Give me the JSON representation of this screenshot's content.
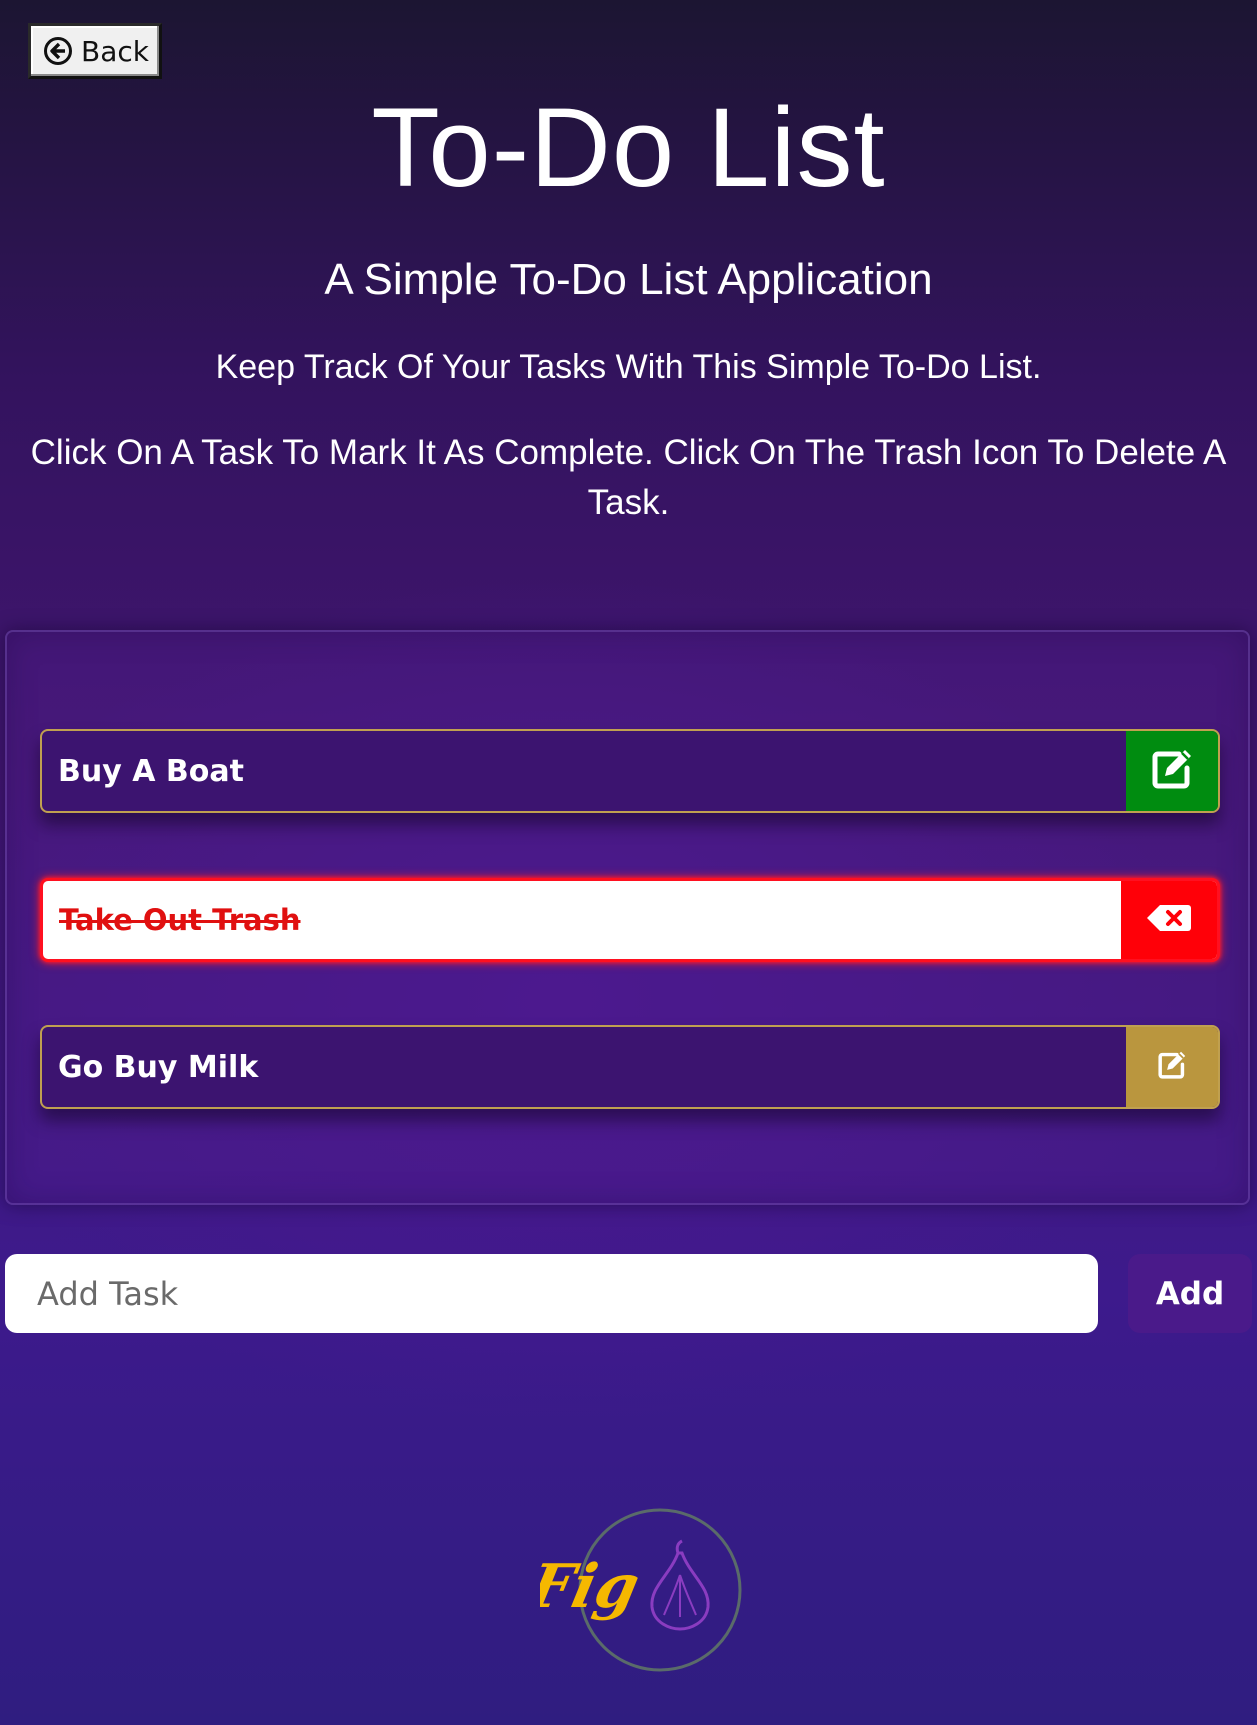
{
  "back_button": {
    "label": "Back",
    "icon": "arrow-left-circle-icon"
  },
  "header": {
    "title": "To-Do List",
    "subtitle": "A Simple To-Do List Application",
    "description": "Keep Track Of Your Tasks With This Simple To-Do List.",
    "instructions": "Click On A Task To Mark It As Complete. Click On The Trash Icon To Delete A Task."
  },
  "tasks": [
    {
      "label": "Buy A Boat",
      "completed": false,
      "action_icon": "edit-icon",
      "action_color": "#008c10"
    },
    {
      "label": "Take Out Trash",
      "completed": true,
      "action_icon": "backspace-delete-icon",
      "action_color": "#ff0008"
    },
    {
      "label": "Go Buy Milk",
      "completed": false,
      "action_icon": "edit-icon",
      "action_color": "#ba963e"
    }
  ],
  "add_task": {
    "placeholder": "Add Task",
    "value": "",
    "button_label": "Add"
  },
  "logo": {
    "text": "Fig",
    "icon": "fig-fruit-icon",
    "text_color": "#f5b800",
    "ring_color": "#5a6b6a"
  }
}
